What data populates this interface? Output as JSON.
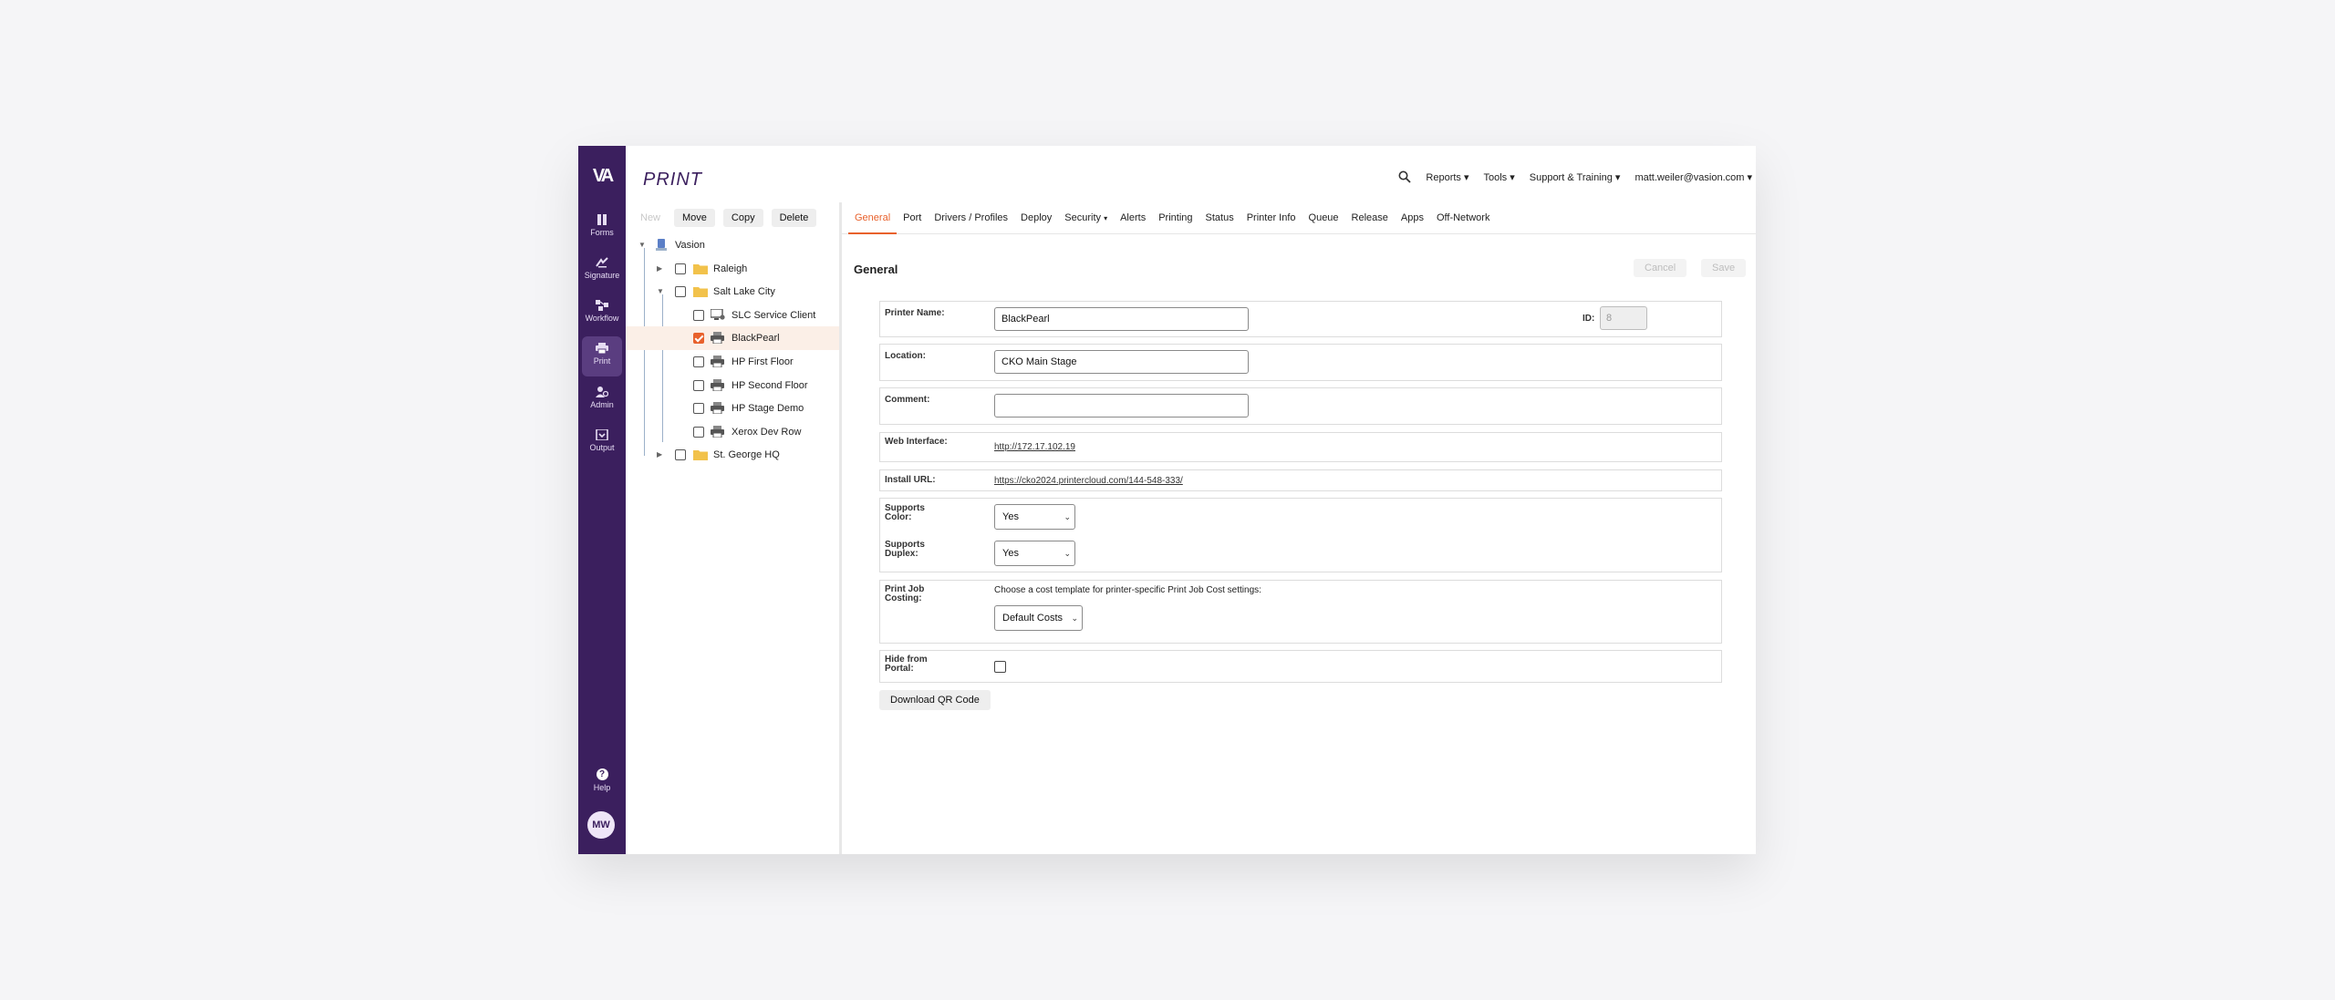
{
  "app": {
    "logo": "VA",
    "brand": "PRINT"
  },
  "rail": {
    "items": [
      {
        "label": "Forms",
        "icon": "forms-icon"
      },
      {
        "label": "Signature",
        "icon": "signature-icon"
      },
      {
        "label": "Workflow",
        "icon": "workflow-icon"
      },
      {
        "label": "Print",
        "icon": "printer-icon",
        "active": true
      },
      {
        "label": "Admin",
        "icon": "admin-icon"
      },
      {
        "label": "Output",
        "icon": "output-icon"
      }
    ],
    "help": "Help",
    "help_glyph": "?",
    "avatar": "MW"
  },
  "topnav": {
    "reports": "Reports ▾",
    "tools": "Tools ▾",
    "support": "Support & Training ▾",
    "user": "matt.weiler@vasion.com ▾"
  },
  "tree_toolbar": {
    "new": "New",
    "move": "Move",
    "copy": "Copy",
    "delete": "Delete"
  },
  "tree": {
    "root": "Vasion",
    "nodes": [
      {
        "label": "Raleigh",
        "type": "folder"
      },
      {
        "label": "Salt Lake City",
        "type": "folder"
      },
      {
        "label": "SLC Service Client",
        "type": "service"
      },
      {
        "label": "BlackPearl",
        "type": "printer",
        "checked": true
      },
      {
        "label": "HP First Floor",
        "type": "printer"
      },
      {
        "label": "HP Second Floor",
        "type": "printer"
      },
      {
        "label": "HP Stage Demo",
        "type": "printer"
      },
      {
        "label": "Xerox Dev Row",
        "type": "printer"
      },
      {
        "label": "St. George HQ",
        "type": "folder"
      }
    ]
  },
  "tabs": [
    "General",
    "Port",
    "Drivers / Profiles",
    "Deploy",
    "Security",
    "Alerts",
    "Printing",
    "Status",
    "Printer Info",
    "Queue",
    "Release",
    "Apps",
    "Off-Network"
  ],
  "tab_caret": "▾",
  "active_tab": "General",
  "section": {
    "title": "General",
    "cancel": "Cancel",
    "save": "Save"
  },
  "form": {
    "printer_name_label": "Printer Name:",
    "printer_name": "BlackPearl",
    "id_label": "ID:",
    "id_value": "8",
    "location_label": "Location:",
    "location": "CKO Main Stage",
    "comment_label": "Comment:",
    "comment": "",
    "web_label": "Web Interface:",
    "web_url": "http://172.17.102.19",
    "install_label": "Install URL:",
    "install_url": "https://cko2024.printercloud.com/144-548-333/",
    "color_label": "Supports Color:",
    "color_value": "Yes",
    "duplex_label": "Supports Duplex:",
    "duplex_value": "Yes",
    "costing_label": "Print Job Costing:",
    "costing_hint": "Choose a cost template for printer-specific Print Job Cost settings:",
    "costing_value": "Default Costs",
    "hide_label": "Hide from Portal:",
    "hide_checked": false,
    "qr_button": "Download QR Code"
  },
  "colors": {
    "rail": "#3b1f5e",
    "accent": "#e8612c",
    "selected_row": "#fbefe7"
  }
}
